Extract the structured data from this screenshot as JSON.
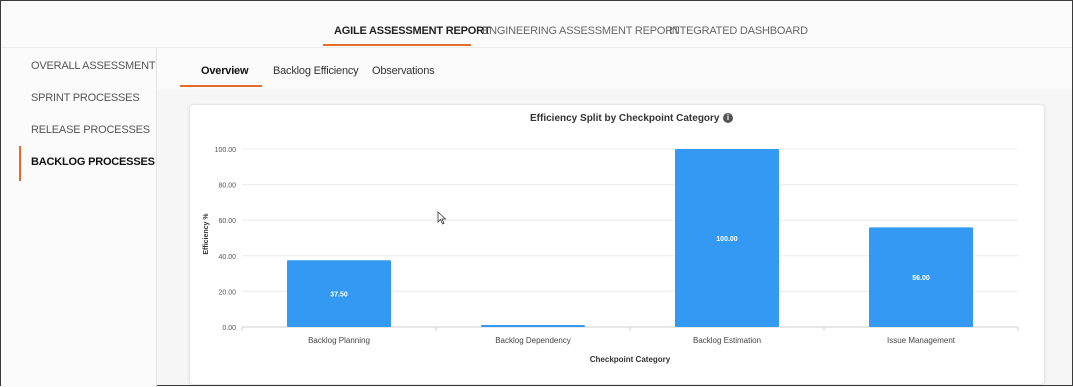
{
  "top_tabs": [
    {
      "label": "AGILE ASSESSMENT REPORT",
      "active": true
    },
    {
      "label": "ENGINEERING ASSESSMENT REPORT",
      "active": false
    },
    {
      "label": "INTEGRATED DASHBOARD",
      "active": false
    }
  ],
  "sidebar": {
    "items": [
      {
        "label": "OVERALL ASSESSMENT",
        "active": false
      },
      {
        "label": "SPRINT PROCESSES",
        "active": false
      },
      {
        "label": "RELEASE PROCESSES",
        "active": false
      },
      {
        "label": "BACKLOG PROCESSES",
        "active": true
      }
    ]
  },
  "sub_tabs": [
    {
      "label": "Overview",
      "active": true
    },
    {
      "label": "Backlog Efficiency",
      "active": false
    },
    {
      "label": "Observations",
      "active": false
    }
  ],
  "colors": {
    "accent": "#e36d2d",
    "bar": "#3399f3"
  },
  "chart_data": {
    "type": "bar",
    "title": "Efficiency Split by Checkpoint Category",
    "xlabel": "Checkpoint Category",
    "ylabel": "Efficiency %",
    "categories": [
      "Backlog Planning",
      "Backlog Dependency",
      "Backlog Estimation",
      "Issue Management"
    ],
    "values": [
      37.5,
      0,
      100,
      56
    ],
    "data_labels": [
      "37.50",
      "",
      "100.00",
      "56.00"
    ],
    "ylim": [
      0,
      100
    ],
    "yticks": [
      "0.00",
      "20.00",
      "40.00",
      "60.00",
      "80.00",
      "100.00"
    ],
    "grid": true,
    "legend": "none"
  }
}
